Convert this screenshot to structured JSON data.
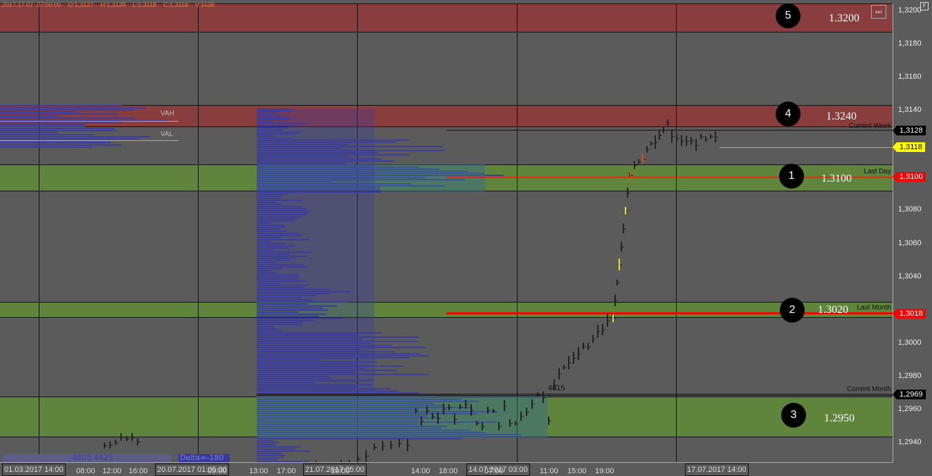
{
  "header": {
    "ohlc": "2017.17.07  07:00:00    O:1,3127    H:1,3128    L:1,3118    C:1,3118    V:1638"
  },
  "price_axis": {
    "labels": [
      "1,3200",
      "1,3180",
      "1,3160",
      "1,3140",
      "1,3080",
      "1,3060",
      "1,3040",
      "1,3000",
      "1,2980",
      "1,2960",
      "1,2940"
    ],
    "tags": [
      {
        "text": "1,3128",
        "bg": "#000000",
        "fg": "#ffffff"
      },
      {
        "text": "1,3118",
        "bg": "#ffff00",
        "fg": "#000000"
      },
      {
        "text": "1,3100",
        "bg": "#ff0000",
        "fg": "#ffffff"
      },
      {
        "text": "1,3018",
        "bg": "#ff0000",
        "fg": "#ffffff"
      },
      {
        "text": "1,2969",
        "bg": "#000000",
        "fg": "#ffffff"
      }
    ]
  },
  "zones": [
    {
      "number": "5",
      "level": "1.3200",
      "color": "#8a3d3d"
    },
    {
      "number": "4",
      "level": "1.3240",
      "color": "#8a3d3d"
    },
    {
      "number": "1",
      "level": "1.3100",
      "color": "#5f843c"
    },
    {
      "number": "2",
      "level": "1.3020",
      "color": "#5f843c"
    },
    {
      "number": "3",
      "level": "1.2950",
      "color": "#5f843c"
    }
  ],
  "levels": {
    "current_week": "Current Week",
    "last_day": "Last Day",
    "last_month": "Last Month",
    "current_month": "Current Month",
    "poc_volume": "4015"
  },
  "left_profile": {
    "vah": "VAH",
    "val": "VAL",
    "volumes": "4605 4425",
    "delta": "Delta=-180"
  },
  "time_axis": {
    "labels": [
      "01.03.2017 14:00",
      "08:00",
      "12:00",
      "16:00",
      "20.07.2017 01:05:00",
      "09:00",
      "13:00",
      "17:00",
      "21.07.2017 05:00",
      "10:00",
      "14:00",
      "18:00",
      "14.07.2017 03:00",
      "07:00",
      "11:00",
      "15:00",
      "19:00",
      "17.07.2017 14:00"
    ]
  },
  "buttons": {
    "scroll_end": "⏭",
    "f": "F"
  }
}
